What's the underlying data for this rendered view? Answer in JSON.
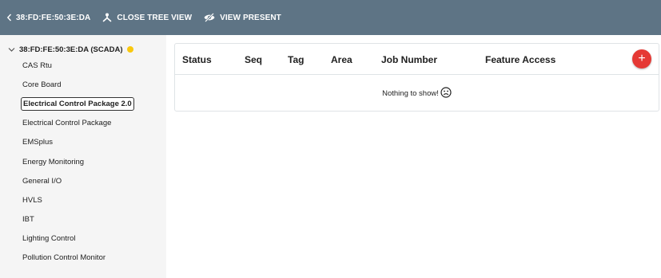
{
  "toolbar": {
    "device_label": "38:FD:FE:50:3E:DA",
    "close_tree_label": "CLOSE TREE VIEW",
    "view_present_label": "VIEW PRESENT",
    "icons": {
      "back": "chevron-left-icon",
      "tree": "tree-icon",
      "view": "eye-off-icon"
    },
    "background_color": "#5e7485"
  },
  "sidebar": {
    "root_label": "38:FD:FE:50:3E:DA (SCADA)",
    "root_status_color": "#f9c80e",
    "items": [
      {
        "label": "CAS Rtu"
      },
      {
        "label": "Core Board"
      },
      {
        "label": "Electrical Control Package 2.0",
        "selected": true
      },
      {
        "label": "Electrical Control Package"
      },
      {
        "label": "EMSplus"
      },
      {
        "label": "Energy Monitoring"
      },
      {
        "label": "General I/O"
      },
      {
        "label": "HVLS"
      },
      {
        "label": "IBT"
      },
      {
        "label": "Lighting Control"
      },
      {
        "label": "Pollution Control Monitor"
      }
    ]
  },
  "table": {
    "columns": [
      "Status",
      "Seq",
      "Tag",
      "Area",
      "Job Number",
      "Feature Access"
    ],
    "add_button_label": "+",
    "add_button_color": "#e53935",
    "empty_message": "Nothing to show!",
    "empty_icon": "sad-face-icon"
  }
}
